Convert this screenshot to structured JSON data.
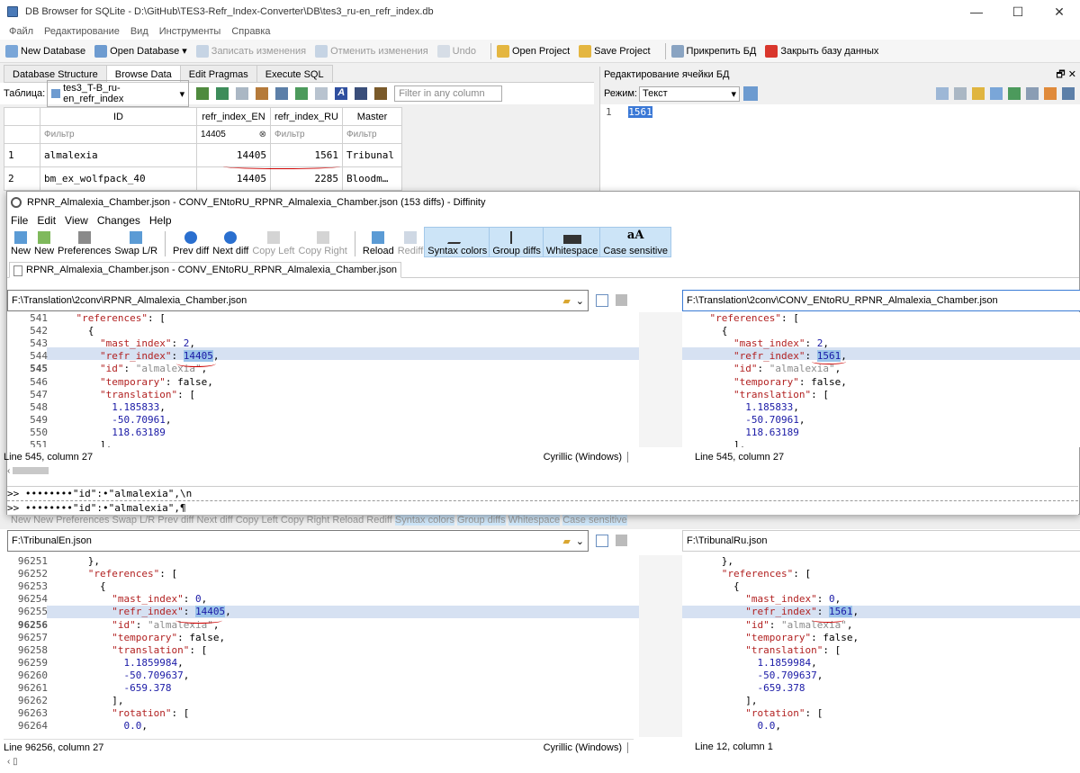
{
  "db": {
    "title": "DB Browser for SQLite - D:\\GitHub\\TES3-Refr_Index-Converter\\DB\\tes3_ru-en_refr_index.db",
    "menu": [
      "Файл",
      "Редактирование",
      "Вид",
      "Инструменты",
      "Справка"
    ],
    "toolbar": {
      "new_db": "New Database",
      "open_db": "Open Database",
      "write": "Записать изменения",
      "revert": "Отменить изменения",
      "undo": "Undo",
      "open_proj": "Open Project",
      "save_proj": "Save Project",
      "attach": "Прикрепить БД",
      "close": "Закрыть базу данных"
    },
    "tabs": [
      "Database Structure",
      "Browse Data",
      "Edit Pragmas",
      "Execute SQL"
    ],
    "table_label": "Таблица:",
    "table_value": "tes3_T-B_ru-en_refr_index",
    "filter_any": "Filter in any column",
    "columns": [
      "ID",
      "refr_index_EN",
      "refr_index_RU",
      "Master"
    ],
    "filters": [
      "Фильтр",
      "14405",
      "Фильтр",
      "Фильтр"
    ],
    "rows": [
      {
        "num": "1",
        "id": "almalexia",
        "en": "14405",
        "ru": "1561",
        "master": "Tribunal"
      },
      {
        "num": "2",
        "id": "bm_ex_wolfpack_40",
        "en": "14405",
        "ru": "2285",
        "master": "Bloodm…"
      }
    ],
    "edit_cell": {
      "title": "Редактирование ячейки БД",
      "mode_label": "Режим:",
      "mode_value": "Текст",
      "line": "1",
      "value": "1561"
    }
  },
  "diff": {
    "title": "RPNR_Almalexia_Chamber.json - CONV_ENtoRU_RPNR_Almalexia_Chamber.json (153 diffs) - Diffinity",
    "menu": [
      "File",
      "Edit",
      "View",
      "Changes",
      "Help"
    ],
    "toolbar": [
      "New",
      "New",
      "Preferences",
      "Swap L/R",
      "Prev diff",
      "Next diff",
      "Copy Left",
      "Copy Right",
      "Reload",
      "Rediff",
      "Syntax colors",
      "Group diffs",
      "Whitespace",
      "Case sensitive"
    ],
    "doc_tab": "RPNR_Almalexia_Chamber.json - CONV_ENtoRU_RPNR_Almalexia_Chamber.json",
    "pane1": {
      "left_path": "F:\\Translation\\2conv\\RPNR_Almalexia_Chamber.json",
      "right_path": "F:\\Translation\\2conv\\CONV_ENtoRU_RPNR_Almalexia_Chamber.json",
      "left_lines": [
        "541",
        "542",
        "543",
        "544",
        "545",
        "546",
        "547",
        "548",
        "549",
        "550",
        "551"
      ],
      "left_code": [
        "    \"references\": [",
        "      {",
        "        \"mast_index\": 2,",
        "        \"refr_index\": 14405,",
        "        \"id\": \"almalexia\",",
        "        \"temporary\": false,",
        "        \"translation\": [",
        "          1.185833,",
        "          -50.70961,",
        "          118.63189",
        "        ],"
      ],
      "right_code": [
        "    \"references\": [",
        "      {",
        "        \"mast_index\": 2,",
        "        \"refr_index\": 1561,",
        "        \"id\": \"almalexia\",",
        "        \"temporary\": false,",
        "        \"translation\": [",
        "          1.185833,",
        "          -50.70961,",
        "          118.63189",
        "        ],"
      ],
      "status_left": "Line 545, column 27",
      "encoding": "Cyrillic (Windows)",
      "status_right": "Line 545, column 27"
    },
    "compare_lines": [
      ">> ••••••••\"id\":•\"almalexia\",\\n",
      ">> ••••••••\"id\":•\"almalexia\",¶"
    ],
    "pane2": {
      "left_path": "F:\\TribunalEn.json",
      "right_path": "F:\\TribunalRu.json",
      "left_lines": [
        "96251",
        "96252",
        "96253",
        "96254",
        "96255",
        "96256",
        "96257",
        "96258",
        "96259",
        "96260",
        "96261",
        "96262",
        "96263",
        "96264"
      ],
      "left_code": [
        "      },",
        "      \"references\": [",
        "        {",
        "          \"mast_index\": 0,",
        "          \"refr_index\": 14405,",
        "          \"id\": \"almalexia\",",
        "          \"temporary\": false,",
        "          \"translation\": [",
        "            1.1859984,",
        "            -50.709637,",
        "            -659.378",
        "          ],",
        "          \"rotation\": [",
        "            0.0,"
      ],
      "right_code": [
        "      },",
        "      \"references\": [",
        "        {",
        "          \"mast_index\": 0,",
        "          \"refr_index\": 1561,",
        "          \"id\": \"almalexia\",",
        "          \"temporary\": false,",
        "          \"translation\": [",
        "            1.1859984,",
        "            -50.709637,",
        "            -659.378",
        "          ],",
        "          \"rotation\": [",
        "            0.0,"
      ],
      "status_left": "Line 96256, column 27",
      "encoding": "Cyrillic (Windows)",
      "status_right": "Line 12, column 1"
    }
  }
}
